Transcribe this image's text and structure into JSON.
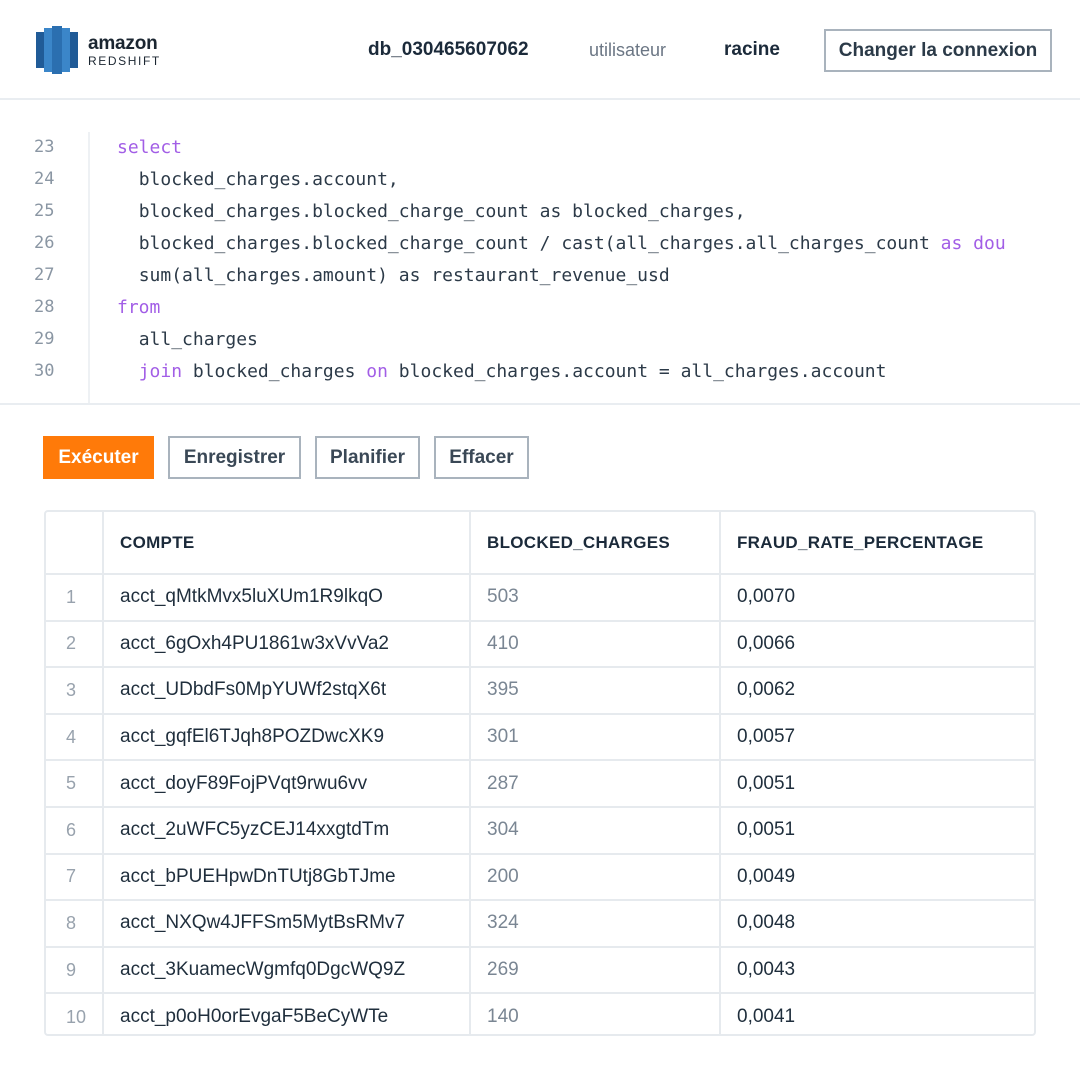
{
  "header": {
    "logo_primary": "amazon",
    "logo_secondary": "REDSHIFT",
    "database": "db_030465607062",
    "user_label": "utilisateur",
    "user_value": "racine",
    "change_connection_label": "Changer la connexion"
  },
  "editor": {
    "lines": [
      {
        "num": "23",
        "indent": "",
        "tokens": [
          {
            "t": "select",
            "k": true
          }
        ]
      },
      {
        "num": "24",
        "indent": "  ",
        "tokens": [
          {
            "t": "blocked_charges.account,",
            "k": false
          }
        ]
      },
      {
        "num": "25",
        "indent": "  ",
        "tokens": [
          {
            "t": "blocked_charges.blocked_charge_count as blocked_charges,",
            "k": false
          }
        ]
      },
      {
        "num": "26",
        "indent": "  ",
        "tokens": [
          {
            "t": "blocked_charges.blocked_charge_count / cast(all_charges.all_charges_count ",
            "k": false
          },
          {
            "t": "as",
            "k": true
          },
          {
            "t": " dou",
            "k": true
          }
        ]
      },
      {
        "num": "27",
        "indent": "  ",
        "tokens": [
          {
            "t": "sum(all_charges.amount) as restaurant_revenue_usd",
            "k": false
          }
        ]
      },
      {
        "num": "28",
        "indent": "",
        "tokens": [
          {
            "t": "from",
            "k": true
          }
        ]
      },
      {
        "num": "29",
        "indent": "  ",
        "tokens": [
          {
            "t": "all_charges",
            "k": false
          }
        ]
      },
      {
        "num": "30",
        "indent": "  ",
        "tokens": [
          {
            "t": "join",
            "k": true
          },
          {
            "t": " blocked_charges ",
            "k": false
          },
          {
            "t": "on",
            "k": true
          },
          {
            "t": " blocked_charges.account = all_charges.account",
            "k": false
          }
        ]
      }
    ]
  },
  "actions": {
    "run": "Exécuter",
    "save": "Enregistrer",
    "schedule": "Planifier",
    "clear": "Effacer"
  },
  "results": {
    "columns": [
      "",
      "COMPTE",
      "BLOCKED_CHARGES",
      "FRAUD_RATE_PERCENTAGE"
    ],
    "rows": [
      [
        "1",
        "acct_qMtkMvx5luXUm1R9lkqO",
        "503",
        "0,0070"
      ],
      [
        "2",
        "acct_6gOxh4PU1861w3xVvVa2",
        "410",
        "0,0066"
      ],
      [
        "3",
        "acct_UDbdFs0MpYUWf2stqX6t",
        "395",
        "0,0062"
      ],
      [
        "4",
        "acct_gqfEl6TJqh8POZDwcXK9",
        "301",
        "0,0057"
      ],
      [
        "5",
        "acct_doyF89FojPVqt9rwu6vv",
        "287",
        "0,0051"
      ],
      [
        "6",
        "acct_2uWFC5yzCEJ14xxgtdTm",
        "304",
        "0,0051"
      ],
      [
        "7",
        "acct_bPUEHpwDnTUtj8GbTJme",
        "200",
        "0,0049"
      ],
      [
        "8",
        "acct_NXQw4JFFSm5MytBsRMv7",
        "324",
        "0,0048"
      ],
      [
        "9",
        "acct_3KuamecWgmfq0DgcWQ9Z",
        "269",
        "0,0043"
      ],
      [
        "10",
        "acct_p0oH0orEvgaF5BeCyWTe",
        "140",
        "0,0041"
      ]
    ]
  },
  "colors": {
    "accent": "#ff7a09",
    "keyword": "#a25ee6",
    "logo_blue": "#2a74b8"
  }
}
